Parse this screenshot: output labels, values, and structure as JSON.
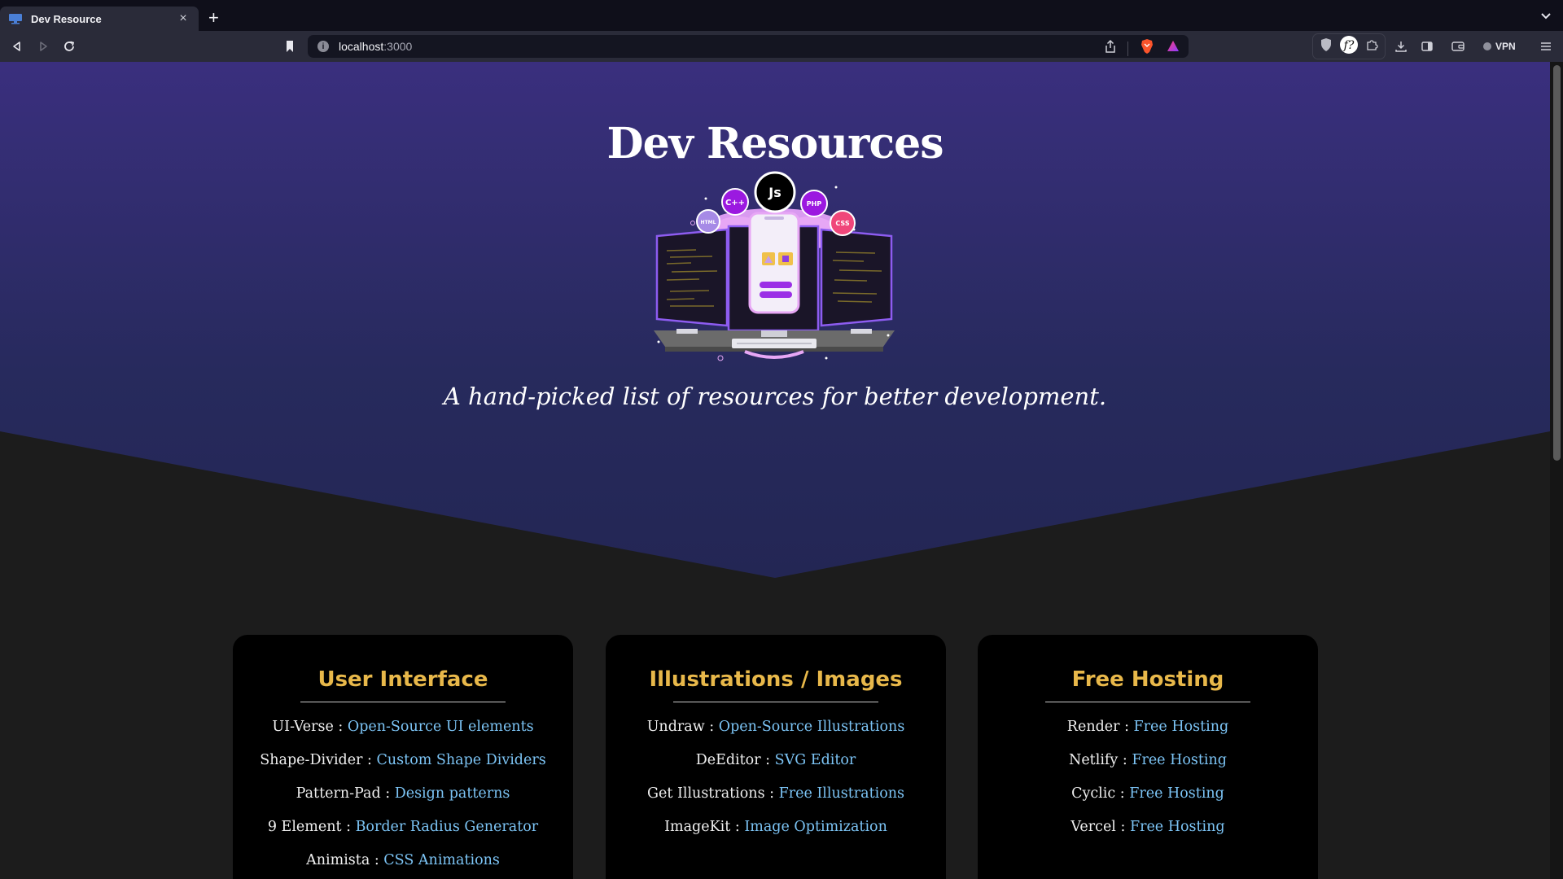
{
  "browser": {
    "tab": {
      "title": "Dev Resource",
      "close": "×"
    },
    "new_tab": "+",
    "address": {
      "host": "localhost",
      "port": ":3000"
    },
    "vpn_label": "VPN"
  },
  "hero": {
    "title": "Dev Resources",
    "subtitle": "A hand-picked list of resources for better development.",
    "bubbles": [
      "Js",
      "C++",
      "PHP",
      "HTML",
      "CSS"
    ]
  },
  "cards": [
    {
      "title": "User Interface",
      "items": [
        {
          "name": "UI-Verse",
          "link": "Open-Source UI elements"
        },
        {
          "name": "Shape-Divider",
          "link": "Custom Shape Dividers"
        },
        {
          "name": "Pattern-Pad",
          "link": "Design patterns"
        },
        {
          "name": "9 Element",
          "link": "Border Radius Generator"
        },
        {
          "name": "Animista",
          "link": "CSS Animations"
        }
      ]
    },
    {
      "title": "Illustrations / Images",
      "items": [
        {
          "name": "Undraw",
          "link": "Open-Source Illustrations"
        },
        {
          "name": "DeEditor",
          "link": "SVG Editor"
        },
        {
          "name": "Get Illustrations",
          "link": "Free Illustrations"
        },
        {
          "name": "ImageKit",
          "link": "Image Optimization"
        }
      ]
    },
    {
      "title": "Free Hosting",
      "items": [
        {
          "name": "Render",
          "link": "Free Hosting"
        },
        {
          "name": "Netlify",
          "link": "Free Hosting"
        },
        {
          "name": "Cyclic",
          "link": "Free Hosting"
        },
        {
          "name": "Vercel",
          "link": "Free Hosting"
        }
      ]
    }
  ],
  "separator": " : ",
  "colors": {
    "hero_top": "#3a2f7e",
    "hero_bottom": "#232654",
    "page_bg": "#1c1c1c",
    "card_bg": "#000000",
    "card_title": "#e8b84a",
    "link": "#7cc4f5"
  }
}
